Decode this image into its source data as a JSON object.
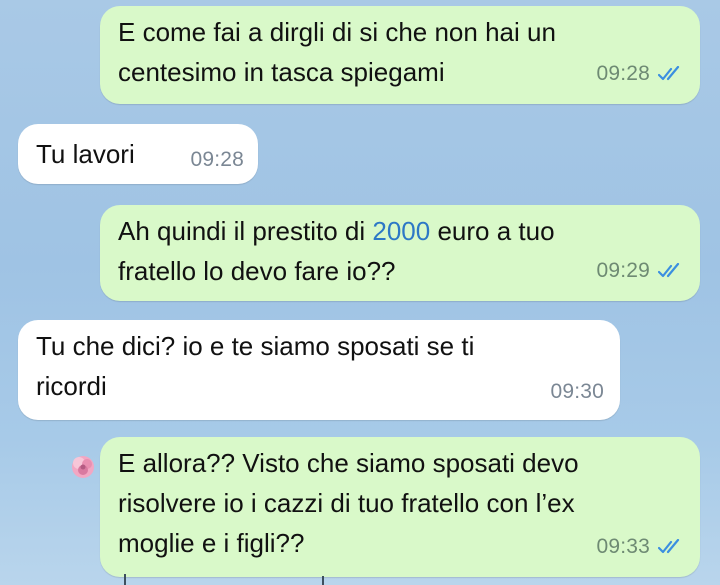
{
  "messages": [
    {
      "direction": "outgoing",
      "text": "E come fai a dirgli di si che non hai un\ncentesimo in tasca spiegami",
      "time": "09:28",
      "status": "read"
    },
    {
      "direction": "incoming",
      "text": "Tu lavori",
      "time": "09:28"
    },
    {
      "direction": "outgoing",
      "text_before": "Ah quindi il prestito di ",
      "highlight": "2000",
      "text_after": " euro a tuo\nfratello lo devo fare io??",
      "time": "09:29",
      "status": "read"
    },
    {
      "direction": "incoming",
      "text": "Tu che dici? io e te siamo sposati se ti\nricordi",
      "time": "09:30"
    },
    {
      "direction": "outgoing",
      "text": "E allora?? Visto che siamo sposati devo\nrisolvere io i cazzi di tuo fratello con l’ex\nmoglie e i figli??",
      "time": "09:33",
      "status": "read"
    }
  ],
  "colors": {
    "outgoing_bubble": "#d9f9c9",
    "incoming_bubble": "#ffffff",
    "read_ticks": "#3b8fe0",
    "number_link": "#2d78c6",
    "wallpaper": "#a9c9e6"
  },
  "icons": {
    "read_receipt": "double-check-icon",
    "reaction": "flower-icon"
  }
}
